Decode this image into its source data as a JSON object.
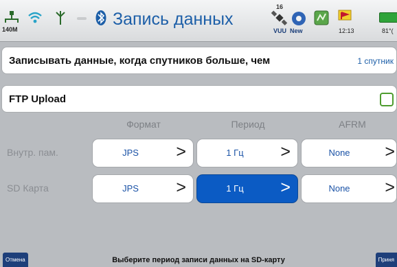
{
  "header": {
    "title": "Запись данных",
    "memory_label": "140M",
    "satellites_count": "16",
    "vuu_label": "VUU",
    "new_label": "New",
    "time": "12:13",
    "battery": "81°("
  },
  "rows": {
    "record_condition_label": "Записывать данные, когда спутников больше, чем",
    "record_condition_value": "1 спутник",
    "ftp_label": "FTP Upload",
    "ftp_checked": false
  },
  "grid": {
    "columns": [
      "Формат",
      "Период",
      "AFRM"
    ],
    "rows": [
      {
        "label": "Внутр. пам.",
        "format": "JPS",
        "period": "1 Гц",
        "afrm": "None"
      },
      {
        "label": "SD Карта",
        "format": "JPS",
        "period": "1 Гц",
        "afrm": "None"
      }
    ],
    "chevron": ">"
  },
  "footer": {
    "cancel_label": "Отмена",
    "status": "Выберите период записи данных на SD-карту",
    "accept_label": "Приня"
  },
  "colors": {
    "accent": "#0b5bc4",
    "title": "#1d5fa8",
    "checkbox_border": "#4d9c2e"
  },
  "icons": [
    "network-icon",
    "wifi-icon",
    "antenna-icon",
    "bluetooth-icon",
    "satellite-icon",
    "new-app-icon",
    "map-icon",
    "flag-icon",
    "battery-icon"
  ]
}
